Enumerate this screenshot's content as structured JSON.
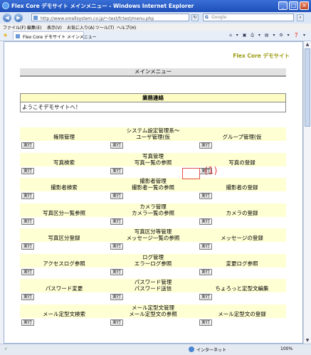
{
  "window": {
    "title": "Flex Core デモサイト メインメニュー - Windows Internet Explorer",
    "minimize": "_",
    "maximize": "□",
    "close": "×"
  },
  "nav": {
    "back": "◀",
    "forward": "▶",
    "address": "http://www.smallsystem.co.jp/〜test/fctest/menu.php",
    "refresh": "↻",
    "stop": "✕",
    "search_placeholder": "Google"
  },
  "menubar": {
    "file": "ファイル(F)",
    "edit": "編集(E)",
    "view": "表示(V)",
    "favorites": "お気に入り(A)",
    "tools": "ツール(T)",
    "help": "ヘルプ(H)"
  },
  "tab": {
    "title": "Flex Core デモサイト メインメニュー"
  },
  "page": {
    "brand": "Flex Core デモサイト",
    "menu_header": "メインメニュー",
    "notice_title": "業務連絡",
    "notice_body": "ようこそデモサイトへ！",
    "run_label": "実行",
    "annotation": "(1)"
  },
  "sections": [
    {
      "title": "システム設定管理系〜",
      "items": [
        "権限管理",
        "ユーザ管理(仮",
        "グループ管理(仮"
      ]
    },
    {
      "title": "写真管理",
      "items": [
        "写真検索",
        "写真一覧の参照",
        "写真の登録"
      ]
    },
    {
      "title": "撮影者管理",
      "items": [
        "撮影者検索",
        "撮影者一覧の参照",
        "撮影者の登録"
      ]
    },
    {
      "title": "カメラ管理",
      "items": [
        "写真区分一覧参照",
        "カメラ一覧の参照",
        "カメラの登録"
      ]
    },
    {
      "title": "写真区分等管理",
      "items": [
        "写真区分登録",
        "メッセージ一覧の参照",
        "メッセージの登録"
      ]
    },
    {
      "title": "ログ管理",
      "items": [
        "アクセスログ参照",
        "エラーログ参照",
        "変更ログ参照"
      ]
    },
    {
      "title": "パスワード管理",
      "items": [
        "パスワード変更",
        "パスワード送信",
        "ちょろっと定型文編集"
      ]
    },
    {
      "title": "メール定型文管理",
      "items": [
        "メール定型文検索",
        "メール定型文の参照",
        "メール定型文の登録"
      ]
    }
  ],
  "status": {
    "done": "✓",
    "zone": "インターネット",
    "zoom": "100%"
  }
}
